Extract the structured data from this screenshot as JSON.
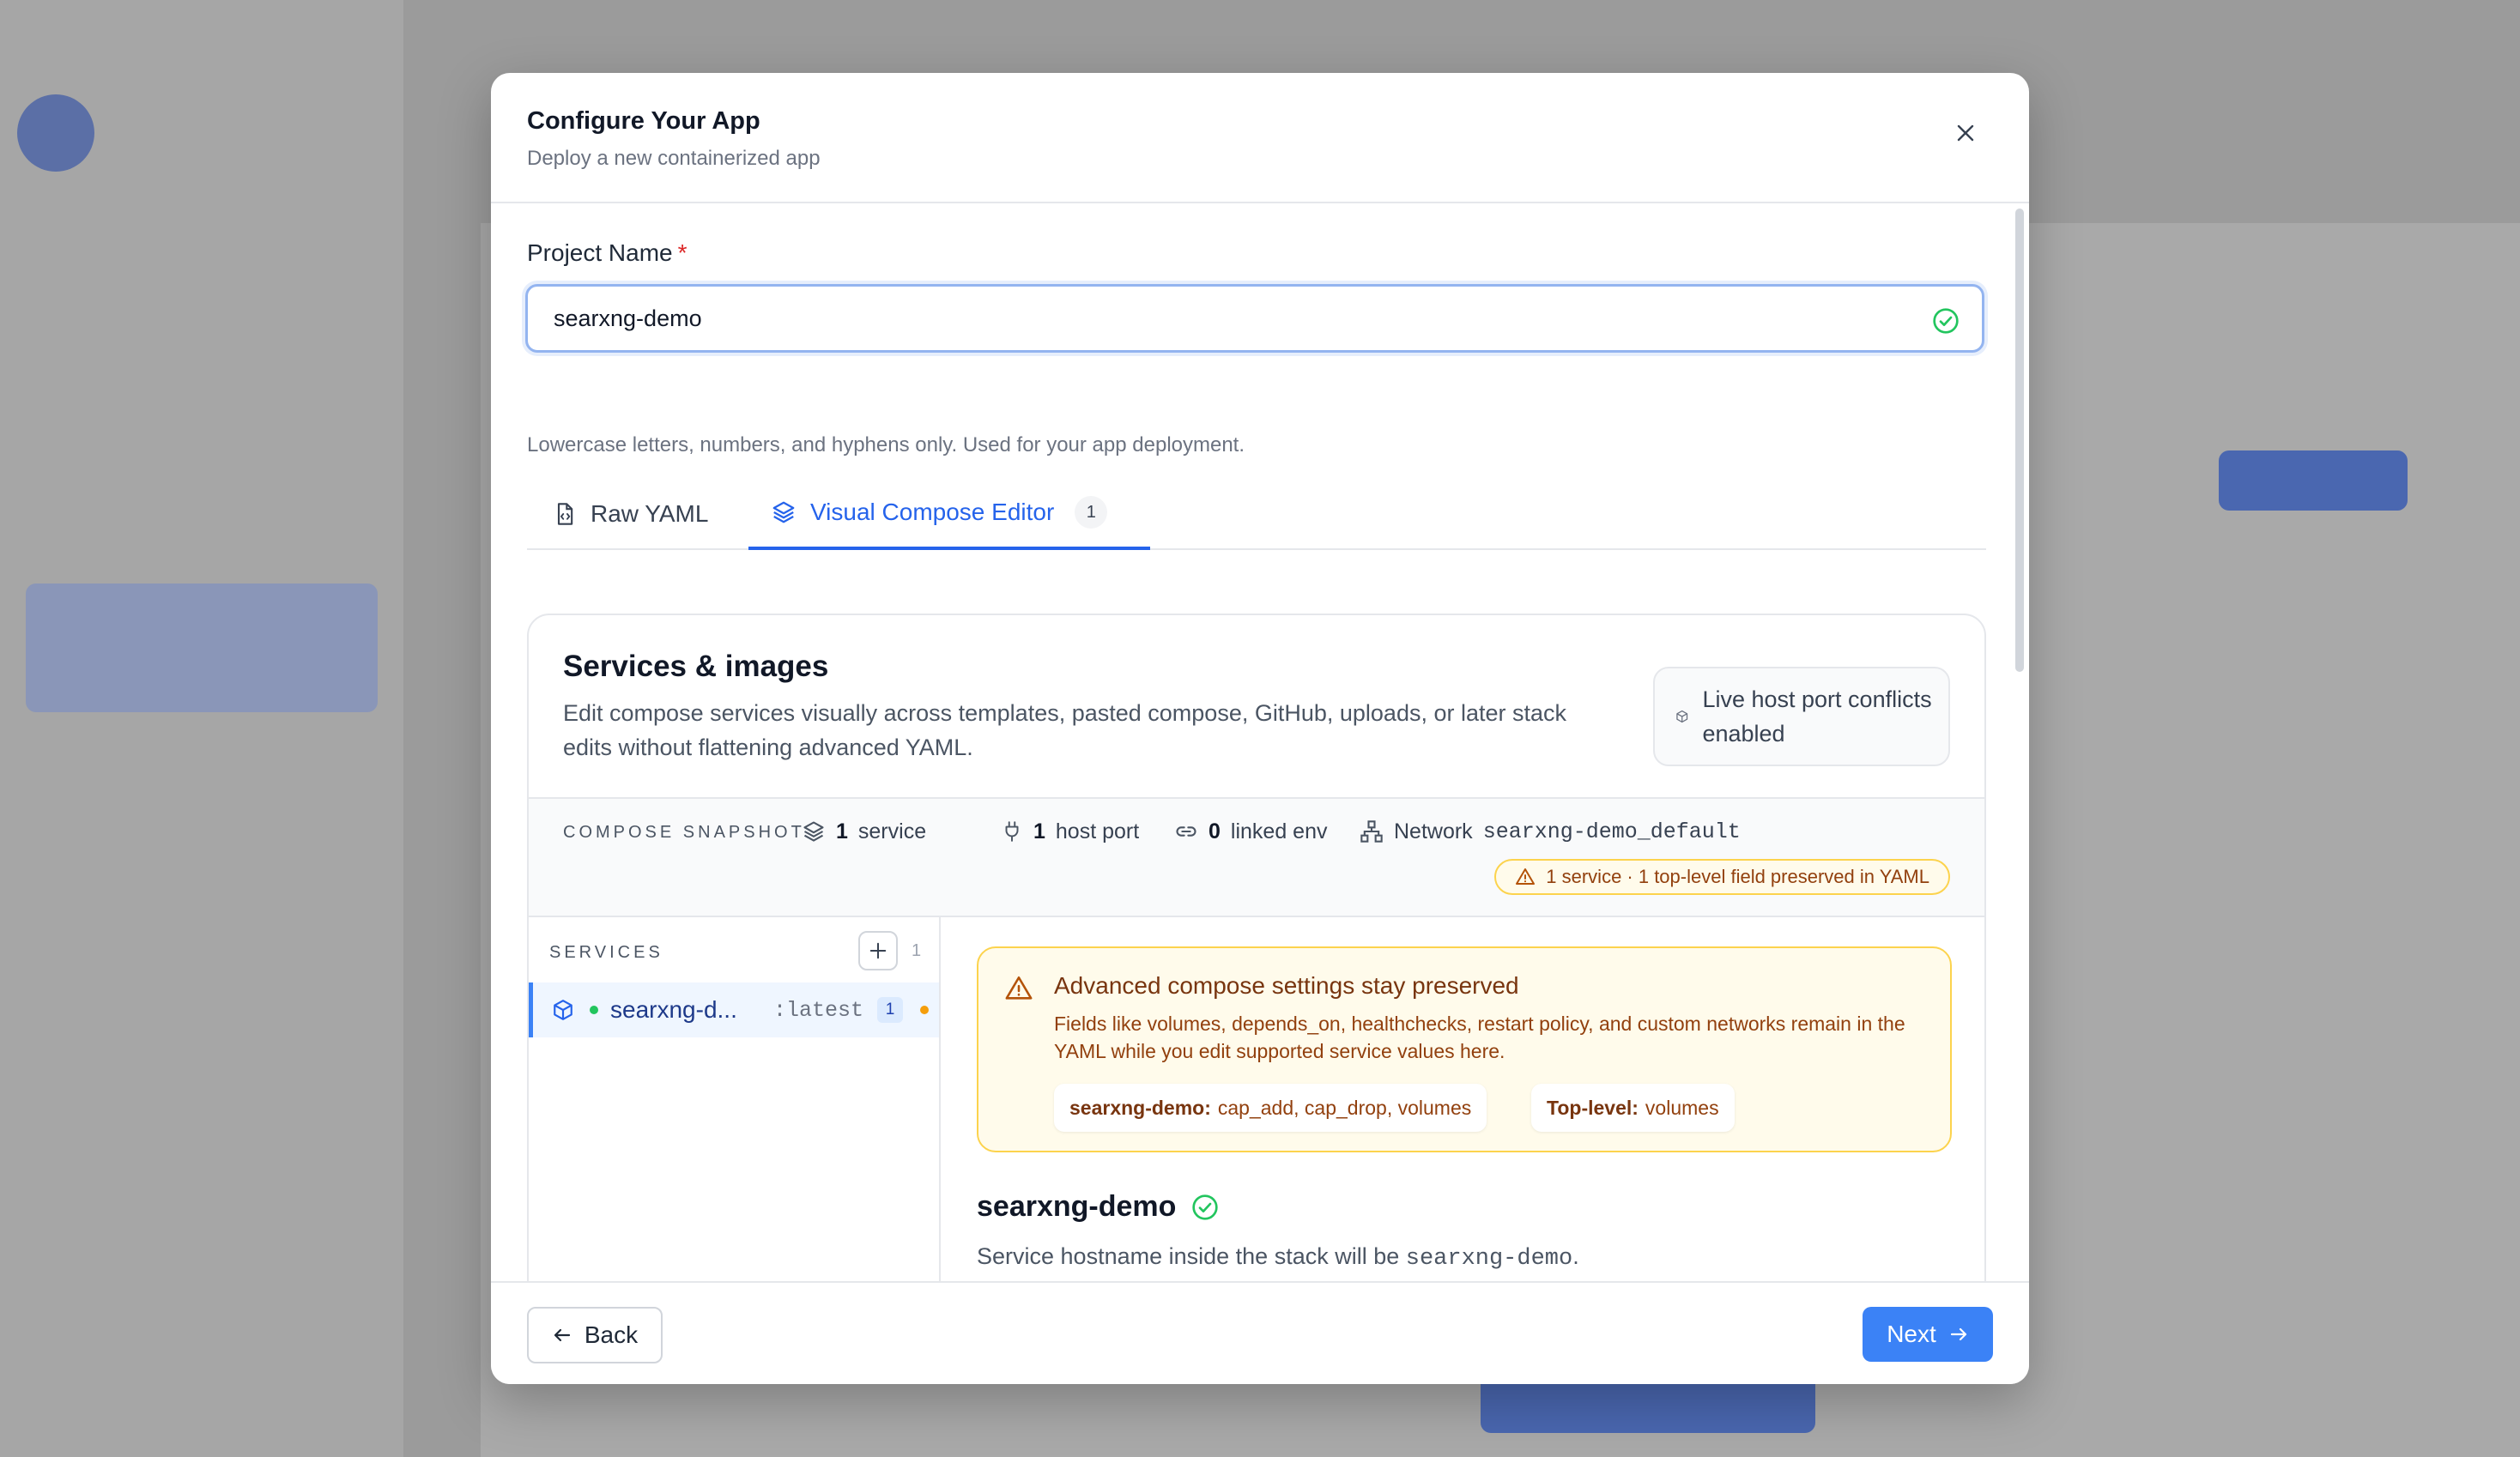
{
  "modal": {
    "title": "Configure Your App",
    "subtitle": "Deploy a new containerized app"
  },
  "project": {
    "label": "Project Name",
    "required_mark": "*",
    "value": "searxng-demo",
    "help": "Lowercase letters, numbers, and hyphens only. Used for your app deployment."
  },
  "tabs": [
    {
      "label": "Raw YAML",
      "icon": "file-code-icon",
      "active": false
    },
    {
      "label": "Visual Compose Editor",
      "icon": "layers-icon",
      "badge": "1",
      "active": true
    }
  ],
  "services_card": {
    "title": "Services & images",
    "description": "Edit compose services visually across templates, pasted compose, GitHub, uploads, or later stack edits without flattening advanced YAML.",
    "live_pill": "Live host port conflicts enabled"
  },
  "snapshot": {
    "label": "COMPOSE SNAPSHOT",
    "service_count": "1",
    "service_label": "service",
    "host_port_count": "1",
    "host_port_label": "host port",
    "linked_env_count": "0",
    "linked_env_label": "linked env",
    "network_label": "Network",
    "network_value": "searxng-demo_default",
    "warning": "1 service · 1 top-level field preserved in YAML"
  },
  "services_panel": {
    "label": "SERVICES",
    "count": "1",
    "items": [
      {
        "name": "searxng-d...",
        "tag": ":latest",
        "count": "1"
      }
    ]
  },
  "advanced": {
    "title": "Advanced compose settings stay preserved",
    "text": "Fields like volumes, depends_on, healthchecks, restart policy, and custom networks remain in the YAML while you edit supported service values here.",
    "chip1_key": "searxng-demo:",
    "chip1_value": "cap_add, cap_drop, volumes",
    "chip2_key": "Top-level:",
    "chip2_value": "volumes"
  },
  "detail": {
    "title": "searxng-demo",
    "subtitle_prefix": "Service hostname inside the stack will be",
    "hostname": "searxng-demo",
    "subtitle_suffix": "."
  },
  "footer": {
    "back_label": "Back",
    "next_label": "Next"
  },
  "colors": {
    "accent": "#3b82f6",
    "success": "#22c55e",
    "warning_bg": "#fffbeb",
    "warning_border": "#fcd34d",
    "warning_text": "#92400e"
  }
}
